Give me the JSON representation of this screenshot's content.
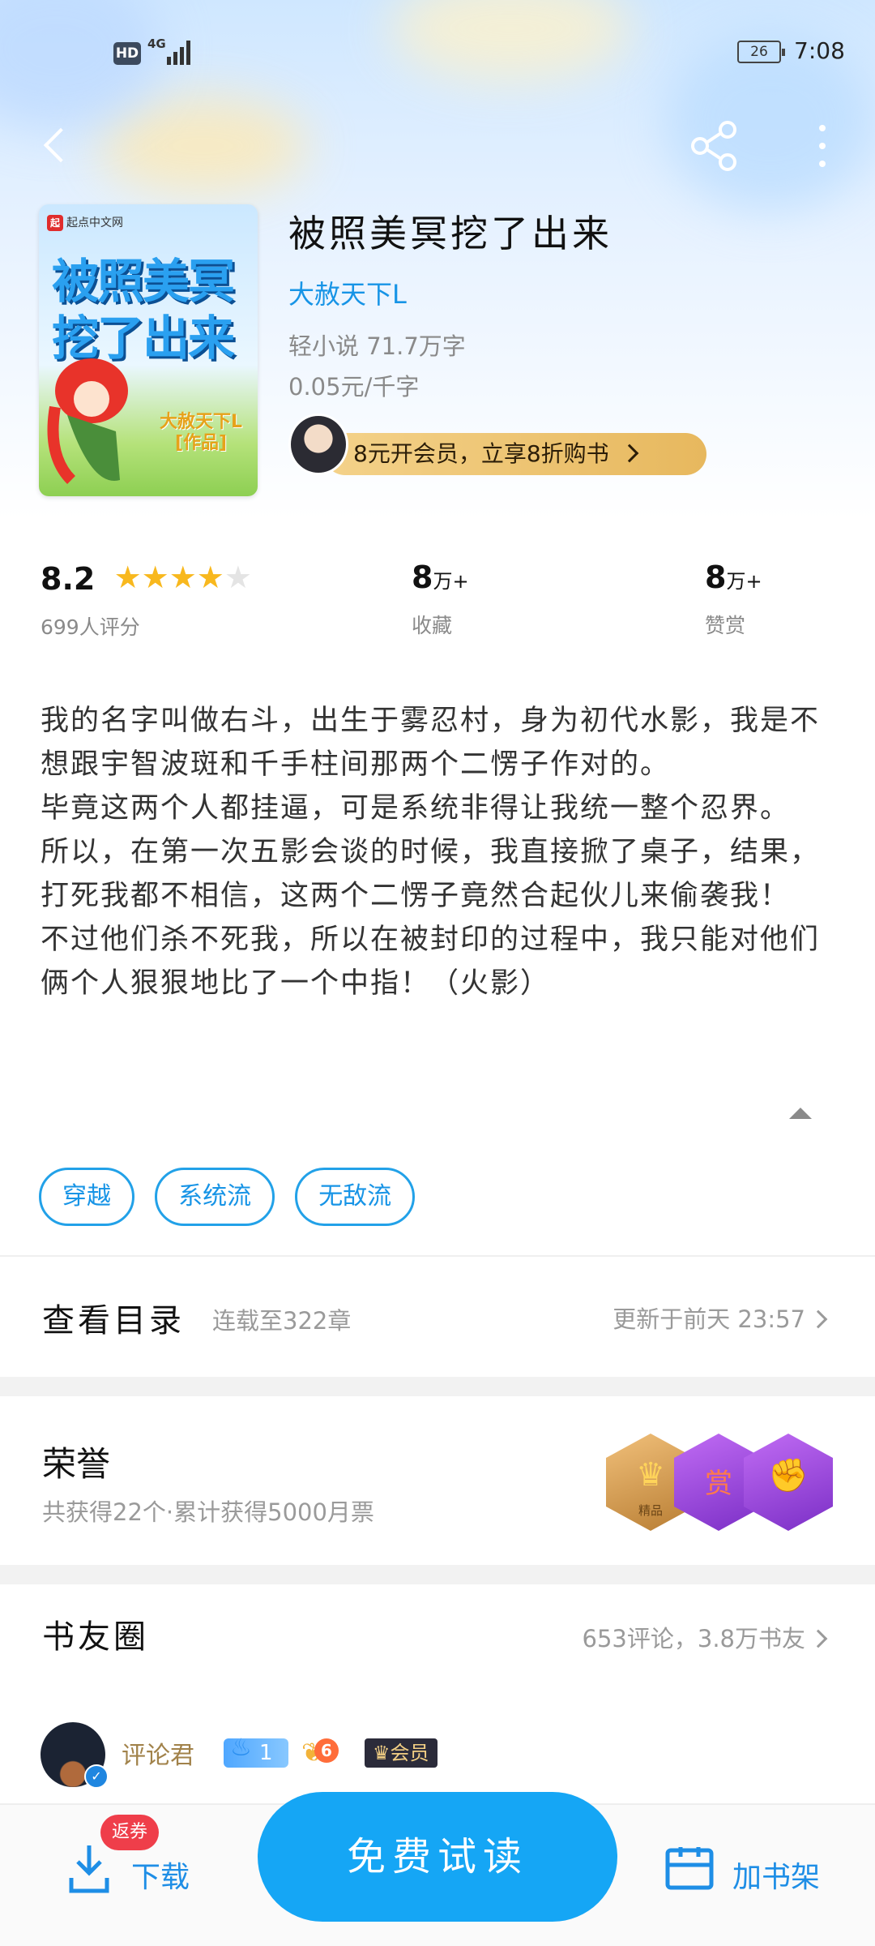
{
  "status_bar": {
    "hd": "HD",
    "network": "4G",
    "battery": "26",
    "time": "7:08"
  },
  "nav": {
    "back_icon": "back-arrow-icon",
    "share_icon": "share-icon",
    "more_icon": "more-vertical-icon"
  },
  "book": {
    "cover": {
      "logo_mark": "起",
      "logo_text": "起点中文网",
      "title_line1": "被照美冥",
      "title_line2": "挖了出来",
      "author_line1": "大赦天下L",
      "author_line2": "[作品]"
    },
    "title": "被照美冥挖了出来",
    "author": "大赦天下L",
    "meta": "轻小说  71.7万字",
    "price": "0.05元/千字",
    "vip_banner": "8元开会员，立享8折购书",
    "stars_filled": 4,
    "stars_total": 5
  },
  "stats": {
    "rating": "8.2",
    "rating_label": "699人评分",
    "collect_num": "8",
    "collect_unit": "万+",
    "collect_label": "收藏",
    "reward_num": "8",
    "reward_unit": "万+",
    "reward_label": "赞赏"
  },
  "intro": [
    "我的名字叫做右斗，出生于雾忍村，身为初代水影，我是不想跟宇智波斑和千手柱间那两个二愣子作对的。",
    "毕竟这两个人都挂逼，可是系统非得让我统一整个忍界。",
    "所以，在第一次五影会谈的时候，我直接掀了桌子，结果，打死我都不相信，这两个二愣子竟然合起伙儿来偷袭我！",
    "不过他们杀不死我，所以在被封印的过程中，我只能对他们俩个人狠狠地比了一个中指！（火影）"
  ],
  "tags": [
    "穿越",
    "系统流",
    "无敌流"
  ],
  "toc": {
    "title": "查看目录",
    "sub": "连载至322章",
    "update": "更新于前天 23:57"
  },
  "honor": {
    "title": "荣誉",
    "sub": "共获得22个·累计获得5000月票",
    "badge1_label": "精品",
    "badge2_glyph": "赏"
  },
  "circle": {
    "title": "书友圈",
    "meta": "653评论，3.8万书友"
  },
  "comment": {
    "user": "评论君",
    "flame_level": "1",
    "wing_level": "6",
    "member": "会员"
  },
  "bottom": {
    "coupon": "返券",
    "download": "下载",
    "read": "免费试读",
    "shelf": "加书架"
  },
  "colors": {
    "accent": "#15a6f5",
    "link": "#1794e6",
    "star": "#f8b81e",
    "coupon": "#ef3e4a"
  }
}
